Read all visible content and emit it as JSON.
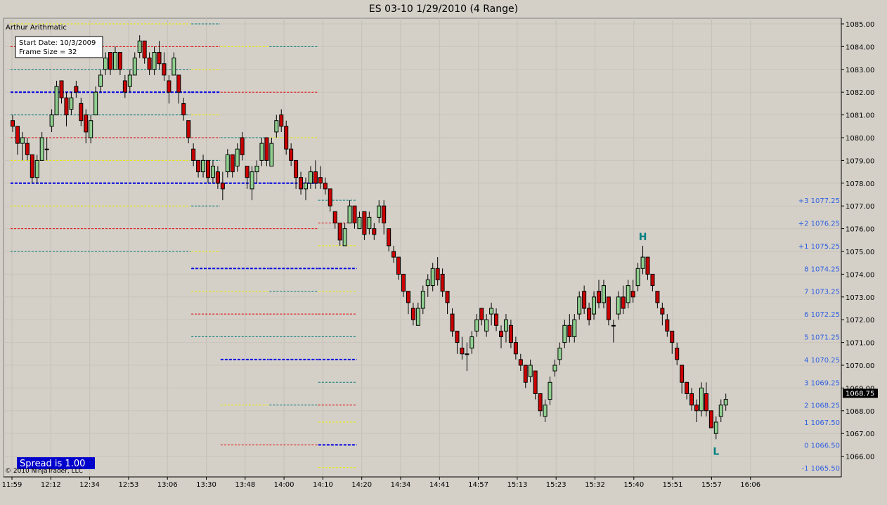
{
  "window_title": "ES 03-10  1/29/2010 (4 Range)",
  "indicator_name": "Arthur Arithmatic",
  "info_box": {
    "start_date": "Start Date: 10/3/2009",
    "frame_size": "Frame Size = 32"
  },
  "spread_label": "Spread is 1.00",
  "copyright": "© 2010 NinjaTrader, LLC",
  "current_price_label": "1068.75",
  "hl_markers": {
    "high": "H",
    "low": "L"
  },
  "colors": {
    "background": "#d4d0c8",
    "plot_bg": "#d4d0c8",
    "bull": "#90d090",
    "bear": "#cc0000",
    "yellow": "#f0f000",
    "red": "#e00000",
    "teal": "#007878",
    "blue": "#0000e0",
    "spread_bg": "#0000cc"
  },
  "chart_data": {
    "type": "candlestick",
    "title": "ES 03-10  1/29/2010 (4 Range)",
    "ylim": [
      1065.5,
      1085.25
    ],
    "y_ticks": [
      "1085.00",
      "1084.00",
      "1083.00",
      "1082.00",
      "1081.00",
      "1080.00",
      "1079.00",
      "1078.00",
      "1077.00",
      "1076.00",
      "1075.00",
      "1074.00",
      "1073.00",
      "1072.00",
      "1071.00",
      "1070.00",
      "1069.00",
      "1068.00",
      "1067.00",
      "1066.00"
    ],
    "x_ticks": [
      "11:59",
      "12:12",
      "12:34",
      "12:53",
      "13:06",
      "13:30",
      "13:48",
      "14:00",
      "14:10",
      "14:20",
      "14:34",
      "14:41",
      "14:57",
      "15:13",
      "15:23",
      "15:32",
      "15:40",
      "15:51",
      "15:57",
      "16:06"
    ],
    "octave_levels": [
      {
        "label": "+3 1077.25",
        "price": 1077.25,
        "color": "teal"
      },
      {
        "label": "+2 1076.25",
        "price": 1076.25,
        "color": "red"
      },
      {
        "label": "+1 1075.25",
        "price": 1075.25,
        "color": "yellow"
      },
      {
        "label": "8 1074.25",
        "price": 1074.25,
        "color": "blue"
      },
      {
        "label": "7 1073.25",
        "price": 1073.25,
        "color": "yellow"
      },
      {
        "label": "6 1072.25",
        "price": 1072.25,
        "color": "red"
      },
      {
        "label": "5 1071.25",
        "price": 1071.25,
        "color": "teal"
      },
      {
        "label": "4 1070.25",
        "price": 1070.25,
        "color": "blue"
      },
      {
        "label": "3 1069.25",
        "price": 1069.25,
        "color": "teal"
      },
      {
        "label": "2 1068.25",
        "price": 1068.25,
        "color": "red"
      },
      {
        "label": "1 1067.50",
        "price": 1067.5,
        "color": "yellow"
      },
      {
        "label": "0 1066.50",
        "price": 1066.5,
        "color": "blue"
      },
      {
        "label": "-1 1065.50",
        "price": 1065.5,
        "color": "yellow"
      }
    ],
    "frame_lines": [
      {
        "start_bar": 0,
        "end_bar": 36,
        "levels": [
          [
            1085.0,
            "yellow"
          ],
          [
            1084.0,
            "red"
          ],
          [
            1083.0,
            "teal"
          ],
          [
            1082.0,
            "blue"
          ],
          [
            1081.0,
            "teal"
          ],
          [
            1080.0,
            "red"
          ],
          [
            1079.0,
            "yellow"
          ],
          [
            1078.0,
            "blue"
          ],
          [
            1077.0,
            "yellow"
          ],
          [
            1076.0,
            "red"
          ],
          [
            1075.0,
            "teal"
          ]
        ]
      },
      {
        "start_bar": 37,
        "end_bar": 42,
        "levels": [
          [
            1085.0,
            "teal"
          ],
          [
            1084.0,
            "red"
          ],
          [
            1083.0,
            "yellow"
          ],
          [
            1082.0,
            "blue"
          ],
          [
            1081.0,
            "yellow"
          ],
          [
            1080.0,
            "red"
          ],
          [
            1079.0,
            "teal"
          ],
          [
            1078.0,
            "blue"
          ],
          [
            1077.0,
            "teal"
          ],
          [
            1076.0,
            "red"
          ],
          [
            1075.0,
            "yellow"
          ],
          [
            1074.25,
            "blue"
          ],
          [
            1073.25,
            "yellow"
          ],
          [
            1072.25,
            "red"
          ],
          [
            1071.25,
            "teal"
          ]
        ]
      },
      {
        "start_bar": 43,
        "end_bar": 52,
        "levels": [
          [
            1084.0,
            "yellow"
          ],
          [
            1082.0,
            "red"
          ],
          [
            1080.0,
            "teal"
          ],
          [
            1078.0,
            "blue"
          ],
          [
            1076.0,
            "red"
          ],
          [
            1074.25,
            "blue"
          ],
          [
            1073.25,
            "yellow"
          ],
          [
            1072.25,
            "red"
          ],
          [
            1071.25,
            "teal"
          ],
          [
            1070.25,
            "blue"
          ],
          [
            1068.25,
            "yellow"
          ],
          [
            1066.5,
            "red"
          ]
        ]
      },
      {
        "start_bar": 53,
        "end_bar": 62,
        "levels": [
          [
            1084.0,
            "teal"
          ],
          [
            1082.0,
            "red"
          ],
          [
            1080.0,
            "yellow"
          ],
          [
            1078.0,
            "blue"
          ],
          [
            1076.0,
            "red"
          ],
          [
            1074.25,
            "blue"
          ],
          [
            1073.25,
            "teal"
          ],
          [
            1072.25,
            "red"
          ],
          [
            1071.25,
            "teal"
          ],
          [
            1070.25,
            "blue"
          ],
          [
            1068.25,
            "teal"
          ],
          [
            1066.5,
            "red"
          ]
        ]
      },
      {
        "start_bar": 63,
        "end_bar": 70,
        "levels": [
          [
            1077.25,
            "teal"
          ],
          [
            1076.25,
            "red"
          ],
          [
            1075.25,
            "yellow"
          ],
          [
            1074.25,
            "blue"
          ],
          [
            1073.25,
            "yellow"
          ],
          [
            1072.25,
            "red"
          ],
          [
            1071.25,
            "teal"
          ],
          [
            1070.25,
            "blue"
          ],
          [
            1069.25,
            "teal"
          ],
          [
            1068.25,
            "red"
          ],
          [
            1067.5,
            "yellow"
          ],
          [
            1066.5,
            "blue"
          ],
          [
            1065.5,
            "yellow"
          ]
        ]
      }
    ],
    "bars": [
      [
        1080.75,
        1081.0,
        1080.25,
        1080.5
      ],
      [
        1080.5,
        1080.5,
        1079.25,
        1079.75
      ],
      [
        1079.75,
        1080.25,
        1079.0,
        1080.0
      ],
      [
        1079.75,
        1080.0,
        1079.0,
        1079.25
      ],
      [
        1079.25,
        1079.25,
        1078.0,
        1078.25
      ],
      [
        1078.25,
        1079.25,
        1078.0,
        1079.0
      ],
      [
        1079.0,
        1080.25,
        1079.0,
        1080.0
      ],
      [
        1079.5,
        1080.0,
        1079.0,
        1079.5
      ],
      [
        1080.5,
        1081.25,
        1080.25,
        1081.0
      ],
      [
        1081.0,
        1082.5,
        1081.0,
        1082.25
      ],
      [
        1082.5,
        1082.5,
        1081.5,
        1081.75
      ],
      [
        1081.75,
        1082.0,
        1080.5,
        1081.0
      ],
      [
        1081.25,
        1082.0,
        1081.0,
        1081.75
      ],
      [
        1082.25,
        1082.5,
        1081.75,
        1082.0
      ],
      [
        1081.5,
        1081.75,
        1080.5,
        1080.75
      ],
      [
        1081.0,
        1081.25,
        1079.75,
        1080.25
      ],
      [
        1080.0,
        1081.0,
        1079.75,
        1080.75
      ],
      [
        1081.0,
        1082.25,
        1081.0,
        1082.0
      ],
      [
        1082.25,
        1083.0,
        1082.0,
        1082.75
      ],
      [
        1083.0,
        1083.75,
        1082.75,
        1083.5
      ],
      [
        1083.75,
        1083.75,
        1082.75,
        1083.0
      ],
      [
        1083.0,
        1084.0,
        1083.0,
        1083.75
      ],
      [
        1083.75,
        1083.75,
        1082.75,
        1083.0
      ],
      [
        1082.5,
        1082.75,
        1081.75,
        1082.0
      ],
      [
        1082.25,
        1083.0,
        1082.0,
        1082.75
      ],
      [
        1082.75,
        1083.75,
        1082.75,
        1083.5
      ],
      [
        1083.75,
        1084.5,
        1083.5,
        1084.25
      ],
      [
        1084.25,
        1084.25,
        1083.25,
        1083.5
      ],
      [
        1083.5,
        1083.75,
        1082.75,
        1083.0
      ],
      [
        1083.0,
        1084.0,
        1082.75,
        1083.75
      ],
      [
        1083.75,
        1084.25,
        1083.0,
        1083.25
      ],
      [
        1083.25,
        1083.75,
        1082.5,
        1082.75
      ],
      [
        1082.5,
        1082.75,
        1081.5,
        1082.0
      ],
      [
        1082.75,
        1083.75,
        1082.75,
        1083.5
      ],
      [
        1082.75,
        1082.75,
        1081.5,
        1082.0
      ],
      [
        1081.5,
        1081.75,
        1080.75,
        1081.0
      ],
      [
        1080.75,
        1080.75,
        1079.75,
        1080.0
      ],
      [
        1079.5,
        1079.75,
        1078.75,
        1079.0
      ],
      [
        1079.0,
        1079.0,
        1078.25,
        1078.5
      ],
      [
        1078.5,
        1079.25,
        1078.25,
        1079.0
      ],
      [
        1079.0,
        1079.0,
        1078.0,
        1078.25
      ],
      [
        1078.25,
        1079.0,
        1078.0,
        1078.75
      ],
      [
        1078.5,
        1078.75,
        1077.75,
        1078.0
      ],
      [
        1078.0,
        1078.5,
        1077.25,
        1077.75
      ],
      [
        1078.5,
        1079.5,
        1078.25,
        1079.25
      ],
      [
        1079.25,
        1079.25,
        1078.25,
        1078.5
      ],
      [
        1078.75,
        1079.75,
        1078.5,
        1079.5
      ],
      [
        1080.0,
        1080.25,
        1079.0,
        1079.25
      ],
      [
        1078.75,
        1078.75,
        1077.75,
        1078.25
      ],
      [
        1077.75,
        1078.75,
        1077.25,
        1078.5
      ],
      [
        1078.5,
        1079.0,
        1078.0,
        1078.75
      ],
      [
        1079.0,
        1080.0,
        1078.75,
        1079.75
      ],
      [
        1080.0,
        1080.0,
        1078.75,
        1079.0
      ],
      [
        1078.75,
        1080.0,
        1078.75,
        1079.75
      ],
      [
        1080.25,
        1081.0,
        1080.0,
        1080.75
      ],
      [
        1081.0,
        1081.25,
        1080.25,
        1080.5
      ],
      [
        1080.5,
        1080.75,
        1079.25,
        1079.5
      ],
      [
        1079.5,
        1079.75,
        1078.75,
        1079.0
      ],
      [
        1079.0,
        1079.0,
        1077.75,
        1078.25
      ],
      [
        1078.25,
        1078.5,
        1077.5,
        1077.75
      ],
      [
        1077.75,
        1078.25,
        1077.25,
        1078.0
      ],
      [
        1078.0,
        1078.75,
        1077.75,
        1078.5
      ],
      [
        1078.5,
        1079.0,
        1077.75,
        1078.0
      ],
      [
        1078.25,
        1078.75,
        1077.75,
        1078.0
      ],
      [
        1078.0,
        1078.25,
        1077.5,
        1077.75
      ],
      [
        1077.75,
        1077.75,
        1076.75,
        1077.0
      ],
      [
        1076.75,
        1076.75,
        1076.0,
        1076.25
      ],
      [
        1076.25,
        1076.25,
        1075.25,
        1075.5
      ],
      [
        1075.25,
        1076.25,
        1075.25,
        1076.0
      ],
      [
        1076.25,
        1077.25,
        1076.25,
        1077.0
      ],
      [
        1077.0,
        1077.0,
        1076.0,
        1076.25
      ],
      [
        1076.0,
        1076.75,
        1076.0,
        1076.5
      ],
      [
        1076.75,
        1076.75,
        1075.5,
        1075.75
      ],
      [
        1076.0,
        1076.75,
        1075.75,
        1076.5
      ],
      [
        1076.0,
        1076.25,
        1075.5,
        1075.75
      ],
      [
        1076.5,
        1077.25,
        1076.25,
        1077.0
      ],
      [
        1077.0,
        1077.25,
        1075.75,
        1076.25
      ],
      [
        1076.0,
        1076.0,
        1075.0,
        1075.25
      ],
      [
        1075.0,
        1075.25,
        1074.5,
        1074.75
      ],
      [
        1074.75,
        1074.75,
        1073.75,
        1074.0
      ],
      [
        1074.0,
        1074.0,
        1073.0,
        1073.25
      ],
      [
        1073.25,
        1073.25,
        1072.25,
        1072.75
      ],
      [
        1072.5,
        1072.75,
        1071.75,
        1072.0
      ],
      [
        1071.75,
        1072.75,
        1071.75,
        1072.5
      ],
      [
        1072.5,
        1073.5,
        1072.25,
        1073.25
      ],
      [
        1073.5,
        1074.0,
        1073.0,
        1073.75
      ],
      [
        1073.5,
        1074.5,
        1073.25,
        1074.25
      ],
      [
        1074.25,
        1074.75,
        1073.5,
        1073.75
      ],
      [
        1074.0,
        1074.25,
        1073.0,
        1073.25
      ],
      [
        1073.25,
        1073.25,
        1072.25,
        1072.75
      ],
      [
        1072.25,
        1072.5,
        1071.25,
        1071.5
      ],
      [
        1071.5,
        1071.5,
        1070.5,
        1071.0
      ],
      [
        1070.75,
        1071.25,
        1070.25,
        1070.5
      ],
      [
        1070.5,
        1071.0,
        1069.75,
        1070.5
      ],
      [
        1070.75,
        1071.5,
        1070.5,
        1071.25
      ],
      [
        1071.5,
        1072.25,
        1071.25,
        1072.0
      ],
      [
        1072.5,
        1072.5,
        1071.75,
        1072.0
      ],
      [
        1071.5,
        1072.25,
        1071.25,
        1072.0
      ],
      [
        1072.25,
        1072.75,
        1071.75,
        1072.5
      ],
      [
        1072.25,
        1072.5,
        1071.5,
        1071.75
      ],
      [
        1071.5,
        1071.75,
        1070.75,
        1071.25
      ],
      [
        1071.5,
        1072.25,
        1071.0,
        1072.0
      ],
      [
        1071.75,
        1072.0,
        1070.75,
        1071.0
      ],
      [
        1071.0,
        1071.25,
        1070.25,
        1070.5
      ],
      [
        1070.25,
        1070.5,
        1069.75,
        1070.0
      ],
      [
        1070.0,
        1070.0,
        1069.0,
        1069.25
      ],
      [
        1069.5,
        1070.25,
        1069.25,
        1070.0
      ],
      [
        1069.75,
        1069.75,
        1068.5,
        1068.75
      ],
      [
        1068.75,
        1068.75,
        1067.75,
        1068.0
      ],
      [
        1067.75,
        1068.5,
        1067.5,
        1068.25
      ],
      [
        1068.5,
        1069.5,
        1068.25,
        1069.25
      ],
      [
        1069.75,
        1070.25,
        1069.5,
        1070.0
      ],
      [
        1070.25,
        1071.0,
        1070.0,
        1070.75
      ],
      [
        1071.0,
        1072.0,
        1070.75,
        1071.75
      ],
      [
        1071.75,
        1072.25,
        1071.0,
        1071.25
      ],
      [
        1071.25,
        1072.25,
        1071.0,
        1072.0
      ],
      [
        1072.25,
        1073.25,
        1072.0,
        1073.0
      ],
      [
        1073.25,
        1073.5,
        1072.25,
        1072.5
      ],
      [
        1072.5,
        1072.75,
        1071.75,
        1072.0
      ],
      [
        1072.25,
        1073.25,
        1072.0,
        1073.0
      ],
      [
        1073.25,
        1073.75,
        1072.5,
        1072.75
      ],
      [
        1072.75,
        1073.75,
        1072.5,
        1073.5
      ],
      [
        1073.0,
        1073.0,
        1071.75,
        1072.0
      ],
      [
        1071.75,
        1072.0,
        1071.0,
        1071.75
      ],
      [
        1072.25,
        1073.25,
        1072.0,
        1073.0
      ],
      [
        1073.0,
        1073.5,
        1072.25,
        1072.5
      ],
      [
        1072.75,
        1073.75,
        1072.5,
        1073.5
      ],
      [
        1073.25,
        1073.75,
        1072.75,
        1073.0
      ],
      [
        1073.5,
        1074.5,
        1073.25,
        1074.25
      ],
      [
        1074.25,
        1075.25,
        1074.0,
        1074.75
      ],
      [
        1074.75,
        1074.75,
        1073.75,
        1074.0
      ],
      [
        1074.0,
        1074.0,
        1073.25,
        1073.5
      ],
      [
        1073.25,
        1073.25,
        1072.5,
        1072.75
      ],
      [
        1072.5,
        1072.75,
        1071.75,
        1072.25
      ],
      [
        1072.0,
        1072.25,
        1071.25,
        1071.5
      ],
      [
        1071.5,
        1071.5,
        1070.5,
        1071.0
      ],
      [
        1070.75,
        1071.0,
        1070.0,
        1070.25
      ],
      [
        1070.0,
        1070.0,
        1068.75,
        1069.25
      ],
      [
        1069.25,
        1069.25,
        1068.5,
        1068.75
      ],
      [
        1068.75,
        1069.0,
        1068.0,
        1068.25
      ],
      [
        1068.25,
        1068.5,
        1067.5,
        1068.0
      ],
      [
        1068.0,
        1069.25,
        1067.75,
        1069.0
      ],
      [
        1068.75,
        1069.25,
        1067.75,
        1068.0
      ],
      [
        1068.0,
        1068.0,
        1067.25,
        1067.25
      ],
      [
        1067.0,
        1067.75,
        1066.75,
        1067.5
      ],
      [
        1067.75,
        1068.5,
        1067.5,
        1068.25
      ],
      [
        1068.25,
        1068.75,
        1068.0,
        1068.5
      ]
    ]
  }
}
